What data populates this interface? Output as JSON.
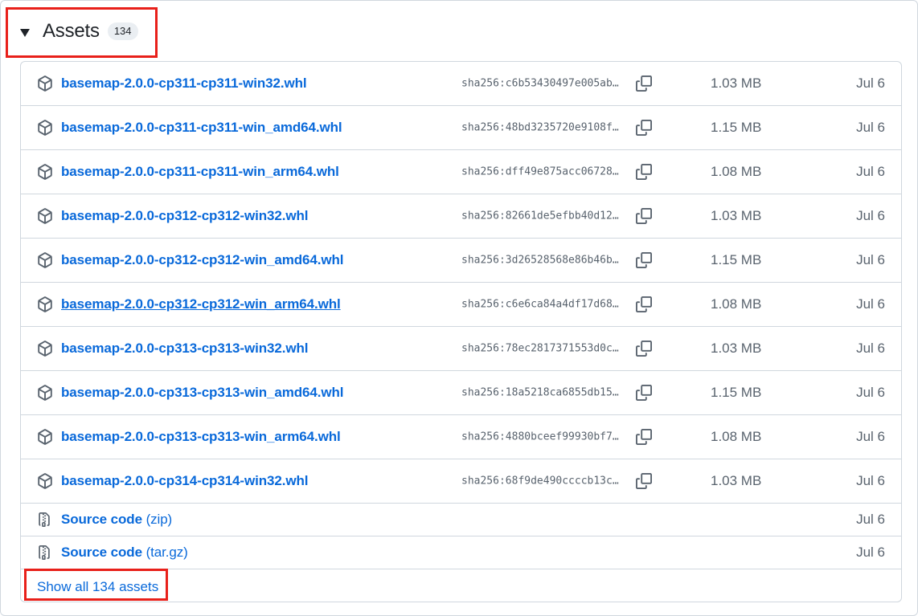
{
  "assets": {
    "title": "Assets",
    "count": "134",
    "show_all_label": "Show all 134 assets",
    "files": [
      {
        "name": "basemap-2.0.0-cp311-cp311-win32.whl",
        "sha": "sha256:c6b53430497e005ab…",
        "size": "1.03 MB",
        "date": "Jul 6"
      },
      {
        "name": "basemap-2.0.0-cp311-cp311-win_amd64.whl",
        "sha": "sha256:48bd3235720e9108f…",
        "size": "1.15 MB",
        "date": "Jul 6"
      },
      {
        "name": "basemap-2.0.0-cp311-cp311-win_arm64.whl",
        "sha": "sha256:dff49e875acc06728…",
        "size": "1.08 MB",
        "date": "Jul 6"
      },
      {
        "name": "basemap-2.0.0-cp312-cp312-win32.whl",
        "sha": "sha256:82661de5efbb40d12…",
        "size": "1.03 MB",
        "date": "Jul 6"
      },
      {
        "name": "basemap-2.0.0-cp312-cp312-win_amd64.whl",
        "sha": "sha256:3d26528568e86b46b…",
        "size": "1.15 MB",
        "date": "Jul 6"
      },
      {
        "name": "basemap-2.0.0-cp312-cp312-win_arm64.whl",
        "sha": "sha256:c6e6ca84a4df17d68…",
        "size": "1.08 MB",
        "date": "Jul 6"
      },
      {
        "name": "basemap-2.0.0-cp313-cp313-win32.whl",
        "sha": "sha256:78ec2817371553d0c…",
        "size": "1.03 MB",
        "date": "Jul 6"
      },
      {
        "name": "basemap-2.0.0-cp313-cp313-win_amd64.whl",
        "sha": "sha256:18a5218ca6855db15…",
        "size": "1.15 MB",
        "date": "Jul 6"
      },
      {
        "name": "basemap-2.0.0-cp313-cp313-win_arm64.whl",
        "sha": "sha256:4880bceef99930bf7…",
        "size": "1.08 MB",
        "date": "Jul 6"
      },
      {
        "name": "basemap-2.0.0-cp314-cp314-win32.whl",
        "sha": "sha256:68f9de490ccccb13c…",
        "size": "1.03 MB",
        "date": "Jul 6"
      }
    ],
    "source": [
      {
        "label": "Source code",
        "suffix": "(zip)",
        "date": "Jul 6"
      },
      {
        "label": "Source code",
        "suffix": "(tar.gz)",
        "date": "Jul 6"
      }
    ]
  },
  "icons": {
    "package": "package-icon",
    "copy": "copy-icon",
    "zip": "file-zip-icon",
    "caret": "triangle-down-icon"
  },
  "colors": {
    "link": "#0969da",
    "muted": "#59636e",
    "border": "#d0d7de",
    "highlight": "#e8201a"
  }
}
